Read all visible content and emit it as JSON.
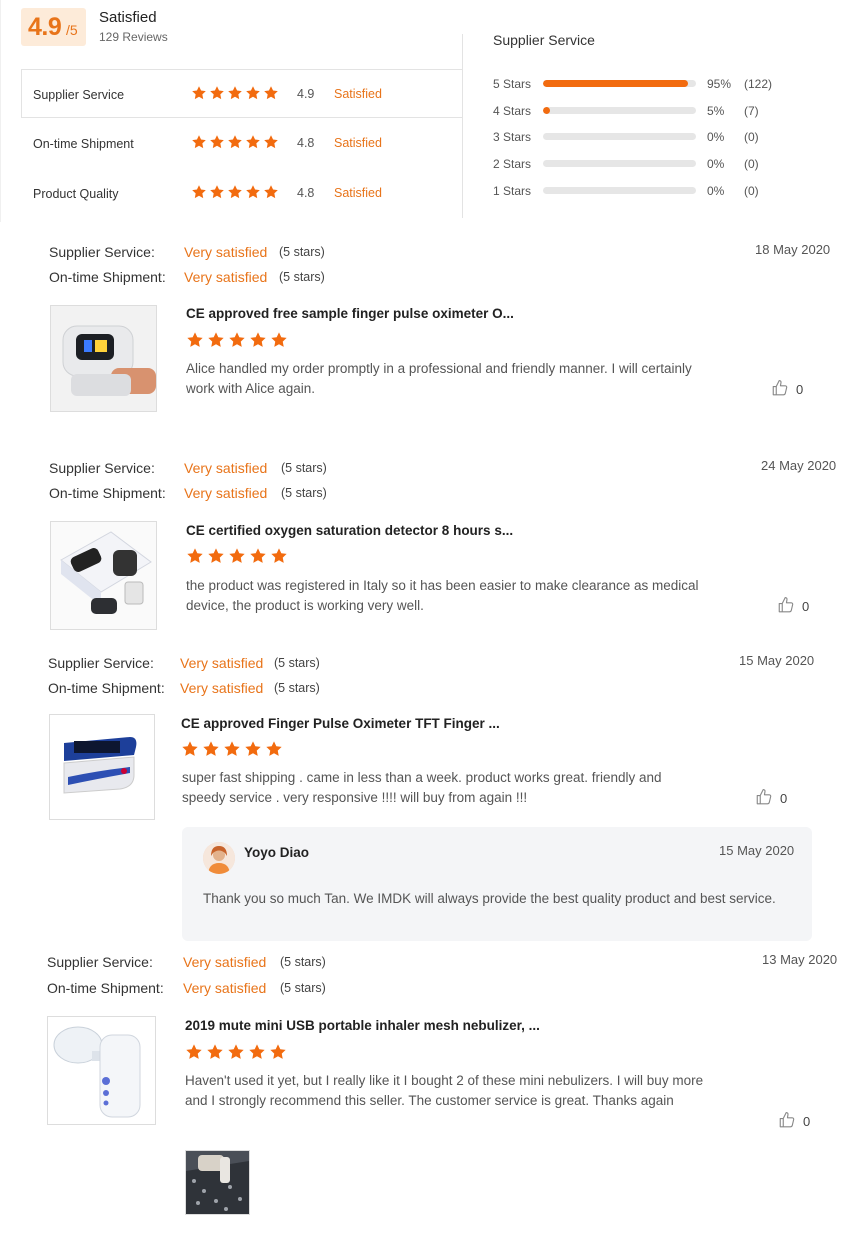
{
  "summary": {
    "score": "4.9",
    "score_denominator": "/5",
    "label": "Satisfied",
    "reviews": "129 Reviews"
  },
  "ratings": [
    {
      "label": "Supplier Service",
      "value": "4.9",
      "status": "Satisfied",
      "stars": 5
    },
    {
      "label": "On-time Shipment",
      "value": "4.8",
      "status": "Satisfied",
      "stars": 5
    },
    {
      "label": "Product Quality",
      "value": "4.8",
      "status": "Satisfied",
      "stars": 5
    }
  ],
  "distribution": {
    "title": "Supplier Service",
    "rows": [
      {
        "label": "5 Stars",
        "fraction": 0.95,
        "percent": "95%",
        "count": "(122)"
      },
      {
        "label": "4 Stars",
        "fraction": 0.05,
        "percent": "5%",
        "count": "(7)"
      },
      {
        "label": "3 Stars",
        "fraction": 0,
        "percent": "0%",
        "count": "(0)"
      },
      {
        "label": "2 Stars",
        "fraction": 0,
        "percent": "0%",
        "count": "(0)"
      },
      {
        "label": "1 Stars",
        "fraction": 0,
        "percent": "0%",
        "count": "(0)"
      }
    ]
  },
  "labels": {
    "supplier_service": "Supplier Service:",
    "on_time_shipment": "On-time Shipment:",
    "very_satisfied": "Very satisfied",
    "five_stars": "(5 stars)"
  },
  "reviews": [
    {
      "date": "18 May 2020",
      "product": "CE approved free sample finger pulse oximeter O...",
      "text": "Alice handled my order promptly in a professional and friendly manner. I will certainly work with Alice again.",
      "likes": "0",
      "rating": 5
    },
    {
      "date": "24 May 2020",
      "product": "CE certified oxygen saturation detector 8 hours s...",
      "text": "the product was registered in Italy so it has been easier to make clearance as medical device, the product is working very well.",
      "likes": "0",
      "rating": 5
    },
    {
      "date": "15 May 2020",
      "product": "CE approved Finger Pulse Oximeter TFT Finger ...",
      "text": "super fast shipping . came in less than a week. product works great. friendly and speedy service . very responsive !!!! will buy from again !!!",
      "likes": "0",
      "rating": 5,
      "reply": {
        "author": "Yoyo Diao",
        "date": "15 May 2020",
        "text": "Thank you so much Tan. We IMDK will always provide the best quality product and best service."
      }
    },
    {
      "date": "13 May 2020",
      "product": "2019 mute mini USB portable inhaler mesh nebulizer, ...",
      "text": "Haven't used it yet, but I really like it I bought 2 of these mini nebulizers. I will buy more and I strongly recommend this seller. The customer service is great. Thanks again",
      "likes": "0",
      "rating": 5
    }
  ],
  "colors": {
    "accent": "#e8741a",
    "bar_fill": "#f26b0f",
    "bar_track": "#e6e6e6"
  },
  "icons": {
    "star": "star-icon",
    "like": "thumbs-up-icon"
  }
}
